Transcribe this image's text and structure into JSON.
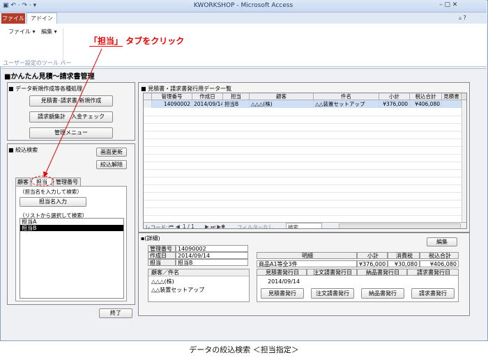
{
  "window": {
    "title": "KWORKSHOP - Microsoft Access",
    "qat": "▣ ↶ · ↷ · ▾",
    "controls": "–  ▢  ✕",
    "ribbon_controls": "▵ ?"
  },
  "ribbon": {
    "tab_file": "ファイル",
    "tab_addin": "アドイン",
    "menu_file": "ファイル ▾",
    "menu_edit": "編集 ▾",
    "toolbar_caption": "ユーザー設定のツール バー"
  },
  "annotation": {
    "text": "「担当」タブをクリック",
    "u1": "「担当」",
    "u2": " タブをクリック"
  },
  "form": {
    "title": "かんたん見積～請求書管理",
    "section_create": "■ データ新規作成等各種処理",
    "btn_new_estimate": "見積書･請求書 新規作成",
    "btn_invoice_total": "請求額集計",
    "btn_payment_check": "入金チェック",
    "btn_admin_menu": "管理メニュー",
    "section_filter": "■ 絞込検索",
    "btn_refresh": "画面更新",
    "btn_clear_filter": "絞込解除",
    "tabs": [
      "顧客",
      "担当",
      "管理番号"
    ],
    "hint_input": "（担当名を入力して検索）",
    "btn_input_name": "担当名入力",
    "hint_list": "（リストから選択して検索）",
    "list_items": [
      {
        "label": "担当A",
        "selected": false
      },
      {
        "label": "担当B",
        "selected": true
      }
    ],
    "btn_close": "終了"
  },
  "grid": {
    "section_title": "■ 見積書・請求書発行用データ一覧",
    "columns": [
      "管理番号",
      "作成日",
      "担当",
      "顧客",
      "件名",
      "小計",
      "税込合計",
      "見積書"
    ],
    "rows": [
      [
        "14090002",
        "2014/09/14",
        "担当B",
        "△△△(株)",
        "△△装置セットアップ",
        "¥376,000",
        "¥406,080",
        ""
      ]
    ],
    "nav_label": "レコード:",
    "nav_first": "⏮",
    "nav_prev": "◀",
    "nav_position": "1 / 1",
    "nav_controls": "▶ ⏭ ▶✱",
    "filter_label": "フィルターなし",
    "search_label": "検索"
  },
  "detail": {
    "title": "(詳細)",
    "btn_edit": "編集",
    "fields": [
      {
        "label": "管理番号",
        "value": "14090002"
      },
      {
        "label": "作成日",
        "value": "2014/09/14"
      },
      {
        "label": "担当",
        "value": "担当B"
      }
    ],
    "customer_label": "顧客／件名",
    "customer_value": "△△△(株)",
    "subject_value": "△△装置セットアップ",
    "summary_headers": [
      "明細",
      "小計",
      "消費税",
      "税込合計"
    ],
    "summary_values": [
      "商品A1等全3件",
      "¥376,000",
      "¥30,080",
      "¥406,080"
    ],
    "issue_headers": [
      "見積書発行日",
      "注文請書発行日",
      "納品書発行日",
      "請求書発行日"
    ],
    "issue_dates": [
      "2014/09/14",
      "",
      "",
      ""
    ],
    "issue_buttons": [
      "見積書発行",
      "注文請書発行",
      "納品書発行",
      "請求書発行"
    ]
  },
  "caption": "データの絞込検索 ＜担当指定＞"
}
